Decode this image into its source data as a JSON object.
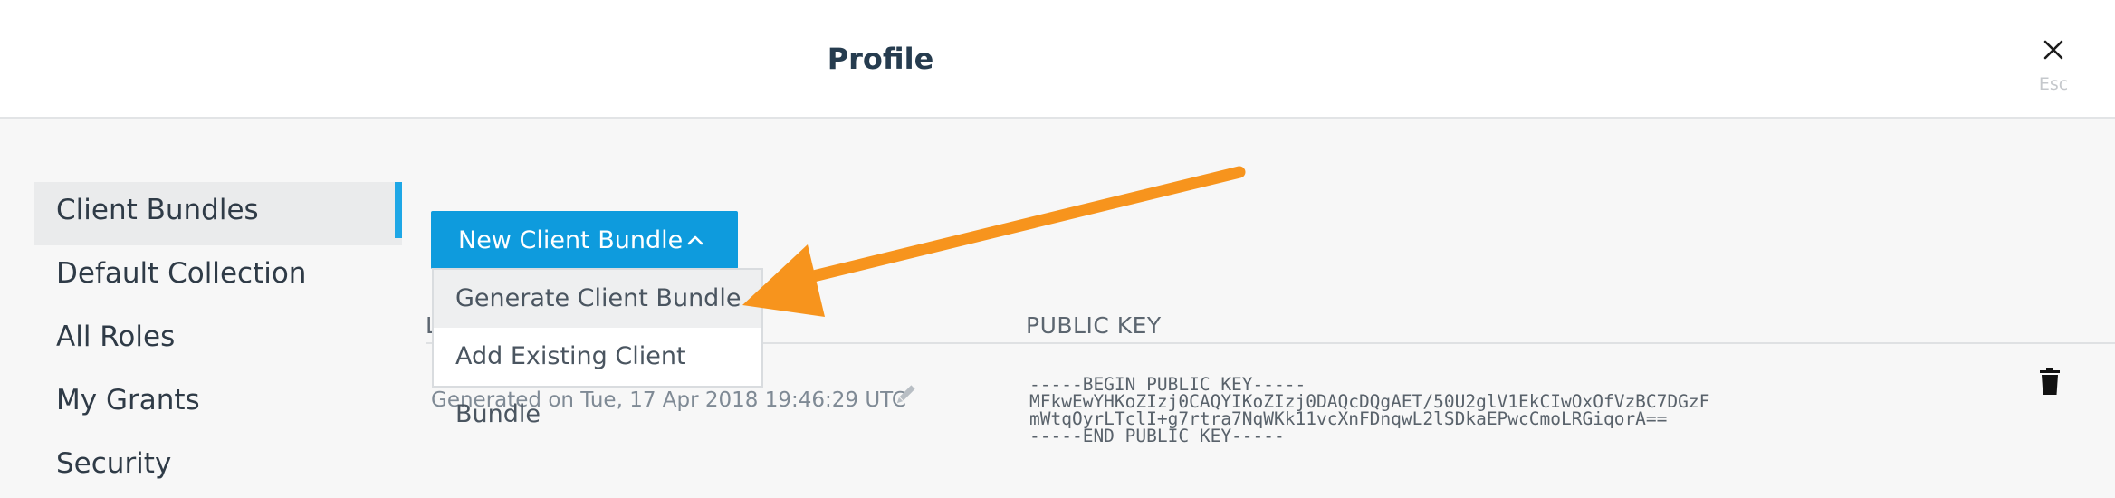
{
  "header": {
    "title": "Profile",
    "close_hint": "Esc"
  },
  "sidebar": {
    "items": [
      {
        "label": "Client Bundles",
        "active": true
      },
      {
        "label": "Default Collection"
      },
      {
        "label": "All Roles"
      },
      {
        "label": "My Grants"
      },
      {
        "label": "Security"
      }
    ]
  },
  "bundle_button": {
    "label": "New Client Bundle"
  },
  "dropdown": {
    "items": [
      {
        "label": "Generate Client Bundle"
      },
      {
        "label": "Add Existing Client Bundle"
      }
    ]
  },
  "table": {
    "col_label_partial": "L",
    "col_public_key": "PUBLIC KEY",
    "rows": [
      {
        "generated": "Generated on Tue, 17 Apr 2018 19:46:29 UTC",
        "public_key": {
          "line1": "-----BEGIN PUBLIC KEY-----",
          "line2": "MFkwEwYHKoZIzj0CAQYIKoZIzj0DAQcDQgAET/50U2glV1EkCIwOxOfVzBC7DGzF",
          "line3": "mWtqOyrLTclI+g7rtra7NqWKk11vcXnFDnqwL2lSDkaEPwcCmoLRGiqorA==",
          "line4": "-----END PUBLIC KEY-----"
        }
      }
    ]
  },
  "icons": {
    "close": "close-icon",
    "chevron": "chevron-up-icon",
    "edit": "pencil-icon",
    "delete": "trash-icon",
    "annotation": "arrow-annotation"
  },
  "colors": {
    "accent": "#1ea7e6",
    "button": "#0e9bdd",
    "annotation_arrow": "#f7941d"
  }
}
